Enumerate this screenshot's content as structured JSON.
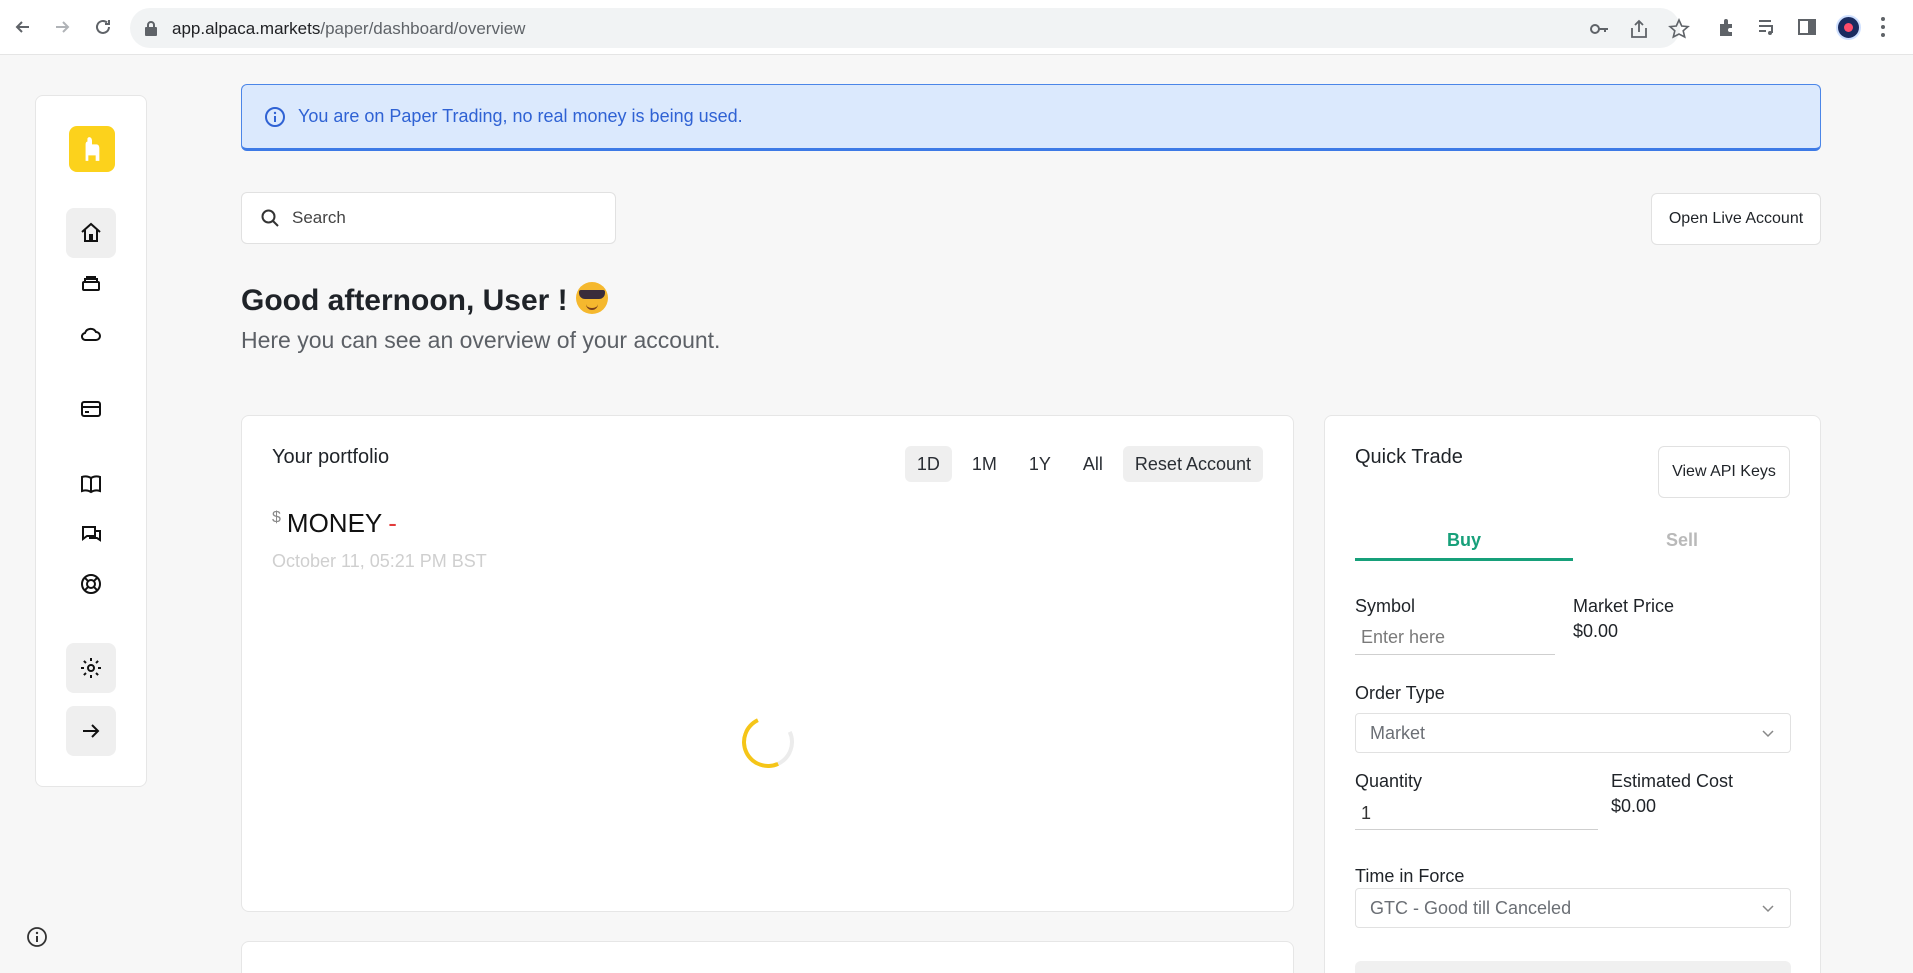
{
  "browser": {
    "url_host": "app.alpaca.markets",
    "url_path": "/paper/dashboard/overview"
  },
  "banner": {
    "text": "You are on Paper Trading, no real money is being used."
  },
  "search": {
    "placeholder": "Search"
  },
  "header": {
    "open_live_label": "Open Live Account"
  },
  "greeting": {
    "title": "Good afternoon, User !",
    "subtitle": "Here you can see an overview of your account."
  },
  "portfolio": {
    "title": "Your portfolio",
    "ranges": [
      "1D",
      "1M",
      "1Y",
      "All"
    ],
    "active_range": "1D",
    "reset_label": "Reset Account",
    "currency": "$",
    "value": "MONEY",
    "change": "-",
    "timestamp": "October 11, 05:21 PM BST"
  },
  "quick_trade": {
    "title": "Quick Trade",
    "api_keys_label": "View API Keys",
    "tabs": [
      "Buy",
      "Sell"
    ],
    "active_tab": "Buy",
    "symbol_label": "Symbol",
    "symbol_placeholder": "Enter here",
    "market_price_label": "Market Price",
    "market_price_value": "$0.00",
    "order_type_label": "Order Type",
    "order_type_value": "Market",
    "quantity_label": "Quantity",
    "quantity_value": "1",
    "estimated_cost_label": "Estimated Cost",
    "estimated_cost_value": "$0.00",
    "time_in_force_label": "Time in Force",
    "time_in_force_value": "GTC - Good till Canceled"
  },
  "sidebar": {
    "items": [
      "home-icon",
      "layers-icon",
      "cloud-icon",
      "card-icon",
      "book-icon",
      "chat-icon",
      "lifebuoy-icon",
      "settings-icon",
      "arrow-right-icon"
    ]
  },
  "colors": {
    "accent_green": "#17a07a",
    "brand_yellow": "#fcd21c",
    "info_blue": "#2f62d4",
    "negative_red": "#e23b3b"
  }
}
